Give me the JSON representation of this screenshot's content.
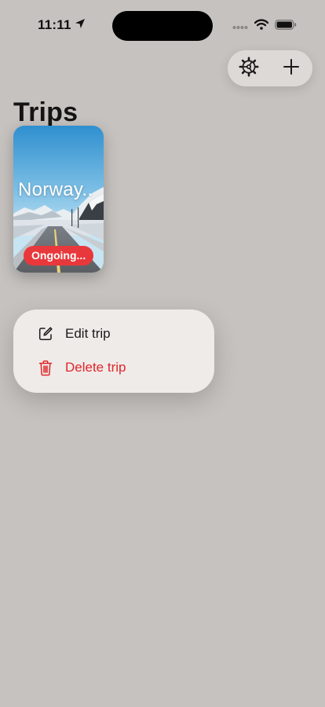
{
  "status_bar": {
    "time": "11:11"
  },
  "header": {
    "title": "Trips"
  },
  "toolbar": {
    "settings_icon": "gear-icon",
    "add_icon": "plus-icon"
  },
  "trips": [
    {
      "name": "Norway..",
      "status": "Ongoing..."
    }
  ],
  "context_menu": {
    "items": [
      {
        "label": "Edit trip",
        "icon": "edit-icon"
      },
      {
        "label": "Delete trip",
        "icon": "trash-icon",
        "color": "#e0262b"
      }
    ]
  },
  "colors": {
    "background": "#c6c2bf",
    "status_badge": "#e8383b",
    "destructive": "#e0262b",
    "menu_background": "#efebe8"
  }
}
